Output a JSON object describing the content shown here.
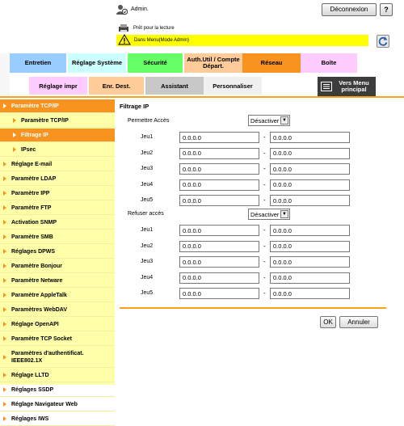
{
  "header": {
    "user": "Admin.",
    "logout_label": "Déconnexion",
    "help_label": "?",
    "status": "Prêt pour la lecture",
    "mode": "Dans Menu(Mode Admin)"
  },
  "tabs": [
    {
      "label": "Entretien",
      "color": "#99ccff"
    },
    {
      "label": "Réglage Système",
      "color": "#ccffff"
    },
    {
      "label": "Sécurité",
      "color": "#66ff66"
    },
    {
      "label": "Auth.Util / Compte Départ.",
      "color": "#ffcc99"
    },
    {
      "label": "Réseau",
      "color": "#f7931e"
    },
    {
      "label": "Boîte",
      "color": "#ffccff"
    }
  ],
  "subtabs": [
    {
      "label": "Réglage impr",
      "color": "#ffccff"
    },
    {
      "label": "Enr. Dest.",
      "color": "#ffcc99"
    },
    {
      "label": "Assistant",
      "color": "#c8c8c8"
    },
    {
      "label": "Personnaliser",
      "color": "#f0f0f0"
    }
  ],
  "menu_button": "Vers Menu principal",
  "sidebar": {
    "items": [
      {
        "label": "Paramètre TCP/IP",
        "level": 0,
        "selected": true
      },
      {
        "label": "Paramètre TCP/IP",
        "level": 1,
        "selected": false
      },
      {
        "label": "Filtrage IP",
        "level": 1,
        "selected": true
      },
      {
        "label": "IPsec",
        "level": 1,
        "selected": false
      },
      {
        "label": "Réglage E-mail",
        "level": 0,
        "selected": false
      },
      {
        "label": "Paramètre LDAP",
        "level": 0,
        "selected": false
      },
      {
        "label": "Paramètre IPP",
        "level": 0,
        "selected": false
      },
      {
        "label": "Paramètre FTP",
        "level": 0,
        "selected": false
      },
      {
        "label": "Activation SNMP",
        "level": 0,
        "selected": false
      },
      {
        "label": "Paramètre SMB",
        "level": 0,
        "selected": false
      },
      {
        "label": "Réglages DPWS",
        "level": 0,
        "selected": false
      },
      {
        "label": "Paramètre Bonjour",
        "level": 0,
        "selected": false
      },
      {
        "label": "Paramètre Netware",
        "level": 0,
        "selected": false
      },
      {
        "label": "Paramètre AppleTalk",
        "level": 0,
        "selected": false
      },
      {
        "label": "Paramètres WebDAV",
        "level": 0,
        "selected": false
      },
      {
        "label": "Réglage OpenAPI",
        "level": 0,
        "selected": false
      },
      {
        "label": "Paramètre TCP Socket",
        "level": 0,
        "selected": false
      },
      {
        "label": "Paramètres d'authentificat. IEEE802.1X",
        "level": 0,
        "selected": false
      },
      {
        "label": "Réglage LLTD",
        "level": 0,
        "selected": false
      },
      {
        "label": "Réglages SSDP",
        "level": 0,
        "selected": false
      },
      {
        "label": "Réglage Navigateur Web",
        "level": 0,
        "selected": false
      },
      {
        "label": "Réglages IWS",
        "level": 0,
        "selected": false
      }
    ]
  },
  "content": {
    "title": "Filtrage IP",
    "permit": {
      "label": "Permettre Accès",
      "select": "Désactiver",
      "rows": [
        {
          "label": "Jeu1",
          "from": "0.0.0.0",
          "to": "0.0.0.0"
        },
        {
          "label": "Jeu2",
          "from": "0.0.0.0",
          "to": "0.0.0.0"
        },
        {
          "label": "Jeu3",
          "from": "0.0.0.0",
          "to": "0.0.0.0"
        },
        {
          "label": "Jeu4",
          "from": "0.0.0.0",
          "to": "0.0.0.0"
        },
        {
          "label": "Jeu5",
          "from": "0.0.0.0",
          "to": "0.0.0.0"
        }
      ]
    },
    "deny": {
      "label": "Refuser accès",
      "select": "Désactiver",
      "rows": [
        {
          "label": "Jeu1",
          "from": "0.0.0.0",
          "to": "0.0.0.0"
        },
        {
          "label": "Jeu2",
          "from": "0.0.0.0",
          "to": "0.0.0.0"
        },
        {
          "label": "Jeu3",
          "from": "0.0.0.0",
          "to": "0.0.0.0"
        },
        {
          "label": "Jeu4",
          "from": "0.0.0.0",
          "to": "0.0.0.0"
        },
        {
          "label": "Jeu5",
          "from": "0.0.0.0",
          "to": "0.0.0.0"
        }
      ]
    },
    "dash": "-",
    "ok_label": "OK",
    "cancel_label": "Annuler"
  }
}
